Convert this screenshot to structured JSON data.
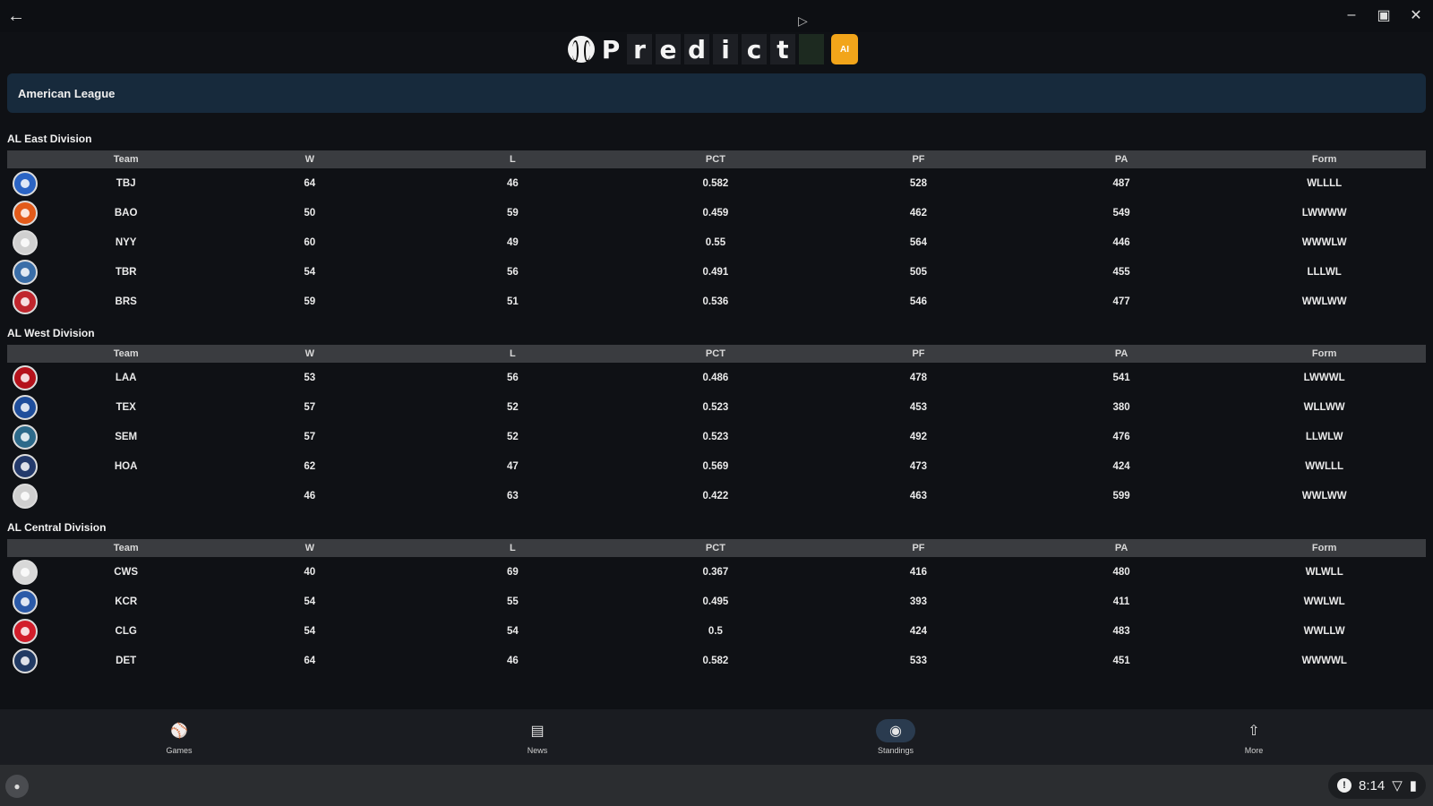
{
  "window": {
    "back_icon": "arrow-left-icon",
    "minimize": "–",
    "maximize": "▣",
    "close": "✕"
  },
  "app": {
    "logo_letters": [
      "P",
      "r",
      "e",
      "d",
      "i",
      "c",
      "t"
    ],
    "logo_badge": "AI"
  },
  "league": {
    "title": "American League"
  },
  "table_headers": [
    "Team",
    "W",
    "L",
    "PCT",
    "PF",
    "PA",
    "Form"
  ],
  "divisions": [
    {
      "title": "AL East Division",
      "rows": [
        {
          "team": "TBJ",
          "w": "64",
          "l": "46",
          "pct": "0.582",
          "pf": "528",
          "pa": "487",
          "form": "WLLLL",
          "color": "#2b64c4"
        },
        {
          "team": "BAO",
          "w": "50",
          "l": "59",
          "pct": "0.459",
          "pf": "462",
          "pa": "549",
          "form": "LWWWW",
          "color": "#e35b1a"
        },
        {
          "team": "NYY",
          "w": "60",
          "l": "49",
          "pct": "0.55",
          "pf": "564",
          "pa": "446",
          "form": "WWWLW",
          "color": "#d0d0d0"
        },
        {
          "team": "TBR",
          "w": "54",
          "l": "56",
          "pct": "0.491",
          "pf": "505",
          "pa": "455",
          "form": "LLLWL",
          "color": "#3a6ea8"
        },
        {
          "team": "BRS",
          "w": "59",
          "l": "51",
          "pct": "0.536",
          "pf": "546",
          "pa": "477",
          "form": "WWLWW",
          "color": "#c0262d"
        }
      ]
    },
    {
      "title": "AL West Division",
      "rows": [
        {
          "team": "LAA",
          "w": "53",
          "l": "56",
          "pct": "0.486",
          "pf": "478",
          "pa": "541",
          "form": "LWWWL",
          "color": "#b5121b"
        },
        {
          "team": "TEX",
          "w": "57",
          "l": "52",
          "pct": "0.523",
          "pf": "453",
          "pa": "380",
          "form": "WLLWW",
          "color": "#1f4e9c"
        },
        {
          "team": "SEM",
          "w": "57",
          "l": "52",
          "pct": "0.523",
          "pf": "492",
          "pa": "476",
          "form": "LLWLW",
          "color": "#2d6a8a"
        },
        {
          "team": "HOA",
          "w": "62",
          "l": "47",
          "pct": "0.569",
          "pf": "473",
          "pa": "424",
          "form": "WWLLL",
          "color": "#243a6b"
        },
        {
          "team": "",
          "w": "46",
          "l": "63",
          "pct": "0.422",
          "pf": "463",
          "pa": "599",
          "form": "WWLWW",
          "color": "#cfcfcf"
        }
      ]
    },
    {
      "title": "AL Central Division",
      "rows": [
        {
          "team": "CWS",
          "w": "40",
          "l": "69",
          "pct": "0.367",
          "pf": "416",
          "pa": "480",
          "form": "WLWLL",
          "color": "#d8d8d8"
        },
        {
          "team": "KCR",
          "w": "54",
          "l": "55",
          "pct": "0.495",
          "pf": "393",
          "pa": "411",
          "form": "WWLWL",
          "color": "#2b5aa8"
        },
        {
          "team": "CLG",
          "w": "54",
          "l": "54",
          "pct": "0.5",
          "pf": "424",
          "pa": "483",
          "form": "WWLLW",
          "color": "#d21e2b"
        },
        {
          "team": "DET",
          "w": "64",
          "l": "46",
          "pct": "0.582",
          "pf": "533",
          "pa": "451",
          "form": "WWWWL",
          "color": "#213a63"
        }
      ]
    }
  ],
  "bottom_nav": [
    {
      "label": "Games",
      "icon": "baseball-bat-icon",
      "glyph": "⚾"
    },
    {
      "label": "News",
      "icon": "news-icon",
      "glyph": "▤"
    },
    {
      "label": "Standings",
      "icon": "standings-icon",
      "glyph": "◉"
    },
    {
      "label": "More",
      "icon": "more-icon",
      "glyph": "⇧"
    }
  ],
  "active_nav": "Standings",
  "taskbar": {
    "time": "8:14",
    "info_glyph": "!",
    "wifi_glyph": "▽",
    "battery_glyph": "▮"
  }
}
